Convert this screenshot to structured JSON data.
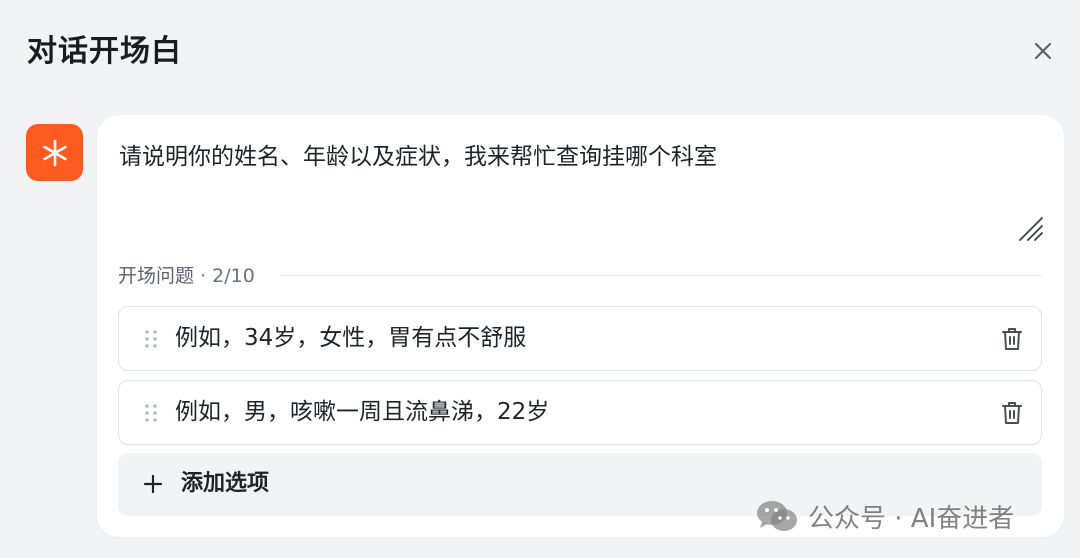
{
  "dialog": {
    "title": "对话开场白",
    "close_icon": "close-icon"
  },
  "bot_avatar": {
    "icon": "asterisk-icon",
    "color": "#ff5a1f"
  },
  "prologue": {
    "text": "请说明你的姓名、年龄以及症状，我来帮忙查询挂哪个科室"
  },
  "opening_questions": {
    "label": "开场问题",
    "count": "· 2/10",
    "items": [
      {
        "text": "例如，34岁，女性，胃有点不舒服"
      },
      {
        "text": "例如，男，咳嗽一周且流鼻涕，22岁"
      }
    ],
    "add_label": "添加选项"
  },
  "watermark": {
    "text": "公众号 · AI奋进者",
    "icon": "wechat-icon"
  }
}
